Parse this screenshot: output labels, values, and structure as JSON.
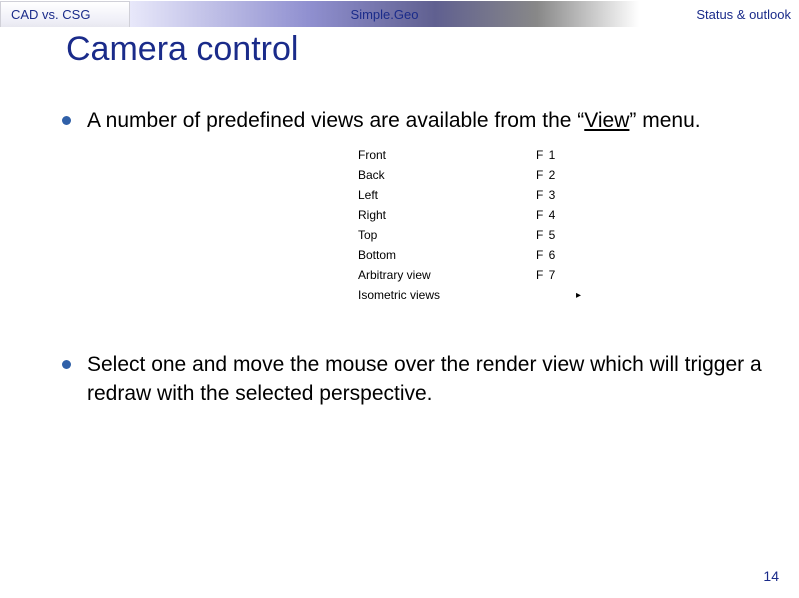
{
  "tabs": {
    "left": "CAD vs. CSG",
    "mid": "Simple.Geo",
    "right": "Status & outlook"
  },
  "title": "Camera control",
  "bullet1_a": "A number of predefined views are available from the “",
  "bullet1_view": "View",
  "bullet1_b": "” menu.",
  "menu": [
    {
      "label": "Front",
      "key": "F 1",
      "arrow": ""
    },
    {
      "label": "Back",
      "key": "F 2",
      "arrow": ""
    },
    {
      "label": "Left",
      "key": "F 3",
      "arrow": ""
    },
    {
      "label": "Right",
      "key": "F 4",
      "arrow": ""
    },
    {
      "label": "Top",
      "key": "F 5",
      "arrow": ""
    },
    {
      "label": "Bottom",
      "key": "F 6",
      "arrow": ""
    },
    {
      "label": "Arbitrary view",
      "key": "F 7",
      "arrow": ""
    },
    {
      "label": "Isometric views",
      "key": "",
      "arrow": "▸"
    }
  ],
  "bullet2": "Select one and move the mouse over the render view which will trigger a redraw with the selected perspective.",
  "page": "14"
}
